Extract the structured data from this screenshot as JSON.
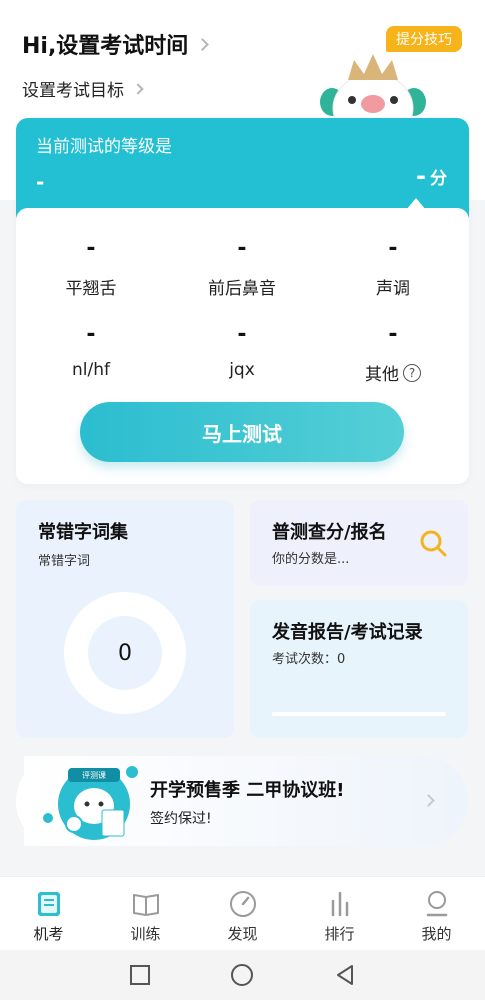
{
  "header": {
    "greeting": "Hi,设置考试时间",
    "goal": "设置考试目标",
    "tips_badge": "提分技巧"
  },
  "level": {
    "label": "当前测试的等级是",
    "grade": "-",
    "score_value": "-",
    "score_unit": "分",
    "items": [
      {
        "label": "平翘舌",
        "value": "-"
      },
      {
        "label": "前后鼻音",
        "value": "-"
      },
      {
        "label": "声调",
        "value": "-"
      },
      {
        "label": "nl/hf",
        "value": "-"
      },
      {
        "label": "jqx",
        "value": "-"
      },
      {
        "label": "其他",
        "value": "-"
      }
    ],
    "help_icon_text": "?",
    "test_button": "马上测试"
  },
  "wrong_words": {
    "title": "常错字词集",
    "subtitle": "常错字词",
    "count": "0"
  },
  "query": {
    "title": "普测查分/报名",
    "subtitle": "你的分数是..."
  },
  "report": {
    "title": "发音报告/考试记录",
    "subtitle": "考试次数：0"
  },
  "promo": {
    "title": "开学预售季 二甲协议班!",
    "subtitle": "签约保过!",
    "illus_text": "评测课"
  },
  "tabs": [
    {
      "label": "机考",
      "icon": "exam-icon",
      "active": true
    },
    {
      "label": "训练",
      "icon": "book-icon",
      "active": false
    },
    {
      "label": "发现",
      "icon": "compass-icon",
      "active": false
    },
    {
      "label": "排行",
      "icon": "bar-chart-icon",
      "active": false
    },
    {
      "label": "我的",
      "icon": "profile-icon",
      "active": false
    }
  ],
  "colors": {
    "accent": "#23bfd3",
    "badge": "#f6b31a",
    "search_icon": "#f3b41c"
  }
}
